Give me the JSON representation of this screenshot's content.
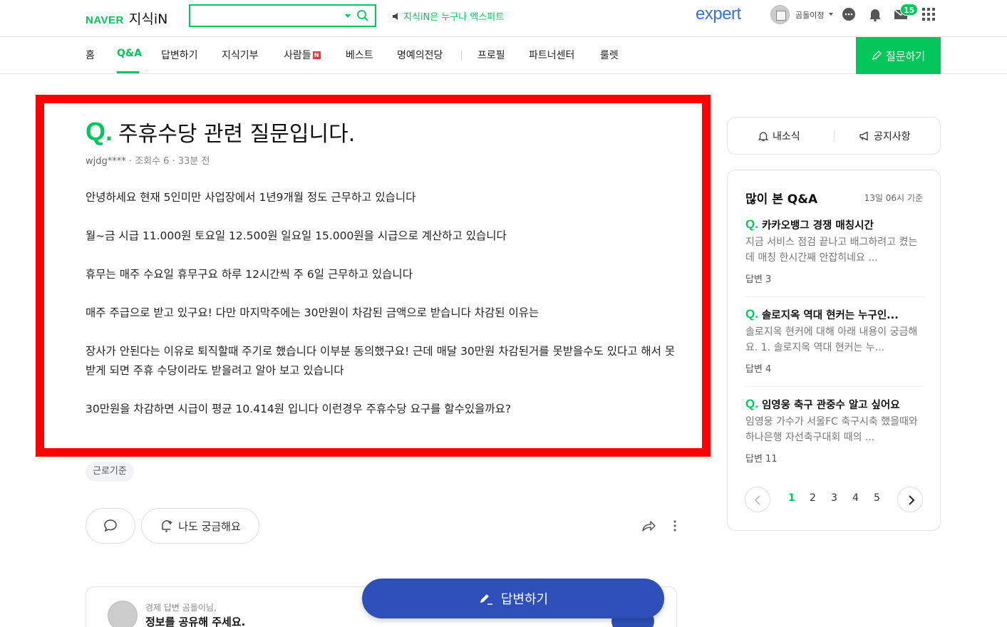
{
  "header": {
    "logo_naver": "NAVER",
    "logo_service": "지식iN",
    "notice": "지식iN은 누구나 엑스퍼트",
    "expert_logo": "expert",
    "username": "곰돌이정",
    "message_count": "15"
  },
  "nav": {
    "items": [
      "홈",
      "Q&A",
      "답변하기",
      "지식기부",
      "사람들",
      "베스트",
      "명예의전당",
      "프로필",
      "파트너센터",
      "룰렛"
    ],
    "new_badge": "N",
    "ask_button": "질문하기"
  },
  "question": {
    "mark": "Q.",
    "title": "주휴수당 관련 질문입니다.",
    "author": "wjdg****",
    "views": "조회수 6",
    "time": "33분 전",
    "paragraphs": [
      "안녕하세요 현재 5인미만 사업장에서 1년9개월 정도 근무하고 있습니다",
      "월~금 시급 11.000원 토요일 12.500원 일요일 15.000원을 시급으로 계산하고 있습니다",
      "휴무는 매주 수요일 휴무구요 하루 12시간씩 주 6일 근무하고 있습니다",
      "매주 주급으로 받고 있구요! 다만 마지막주에는 30만원이 차감된 금액으로 받습니다 차감된 이유는",
      "장사가 안된다는 이유로 퇴직할때 주기로 했습니다 이부분 동의했구요! 근데 매달 30만원 차감된거를 못받을수도 있다고 해서 못받게 되면 주휴 수당이라도 받을려고 알아 보고 있습니다",
      "30만원을 차감하면 시급이 평균 10.414원 입니다 이런경우 주휴수당 요구를 할수있을까요?"
    ],
    "tag": "근로기준",
    "curious_button": "나도 궁금해요"
  },
  "answer_prompt": {
    "sub": "경제 답변 곰돌이님,",
    "main": "정보를 공유해 주세요."
  },
  "answer_fab": "답변하기",
  "sidebar": {
    "tab_news": "내소식",
    "tab_notice": "공지사항",
    "popular_title": "많이 본 Q&A",
    "popular_time": "13일 06시 기준",
    "items": [
      {
        "mark": "Q.",
        "title": "카카오뱅그 경쟁 매칭시간",
        "desc": "지금 서비스 점검 끝나고 배그하려고 켰는데 매칭 한시간째 안잡히네요 ...",
        "count": "답변 3"
      },
      {
        "mark": "Q.",
        "title": "솔로지옥 역대 현커는 누구인...",
        "desc": "솔로지옥 현커에 대해 아래 내용이 궁금해요. 1. 솔로지옥 역대 현커는 누...",
        "count": "답변 4"
      },
      {
        "mark": "Q.",
        "title": "임영웅 축구 관중수 알고 싶어요",
        "desc": "임영웅 가수가 서울FC 축구시축 했을때와 하나은행 자선축구대회 때의 ...",
        "count": "답변 11"
      }
    ],
    "pages": [
      "1",
      "2",
      "3",
      "4",
      "5"
    ]
  },
  "colors": {
    "naver_green": "#03c75a",
    "highlight_red": "#ff0000",
    "answer_blue": "#2e4fb7"
  }
}
